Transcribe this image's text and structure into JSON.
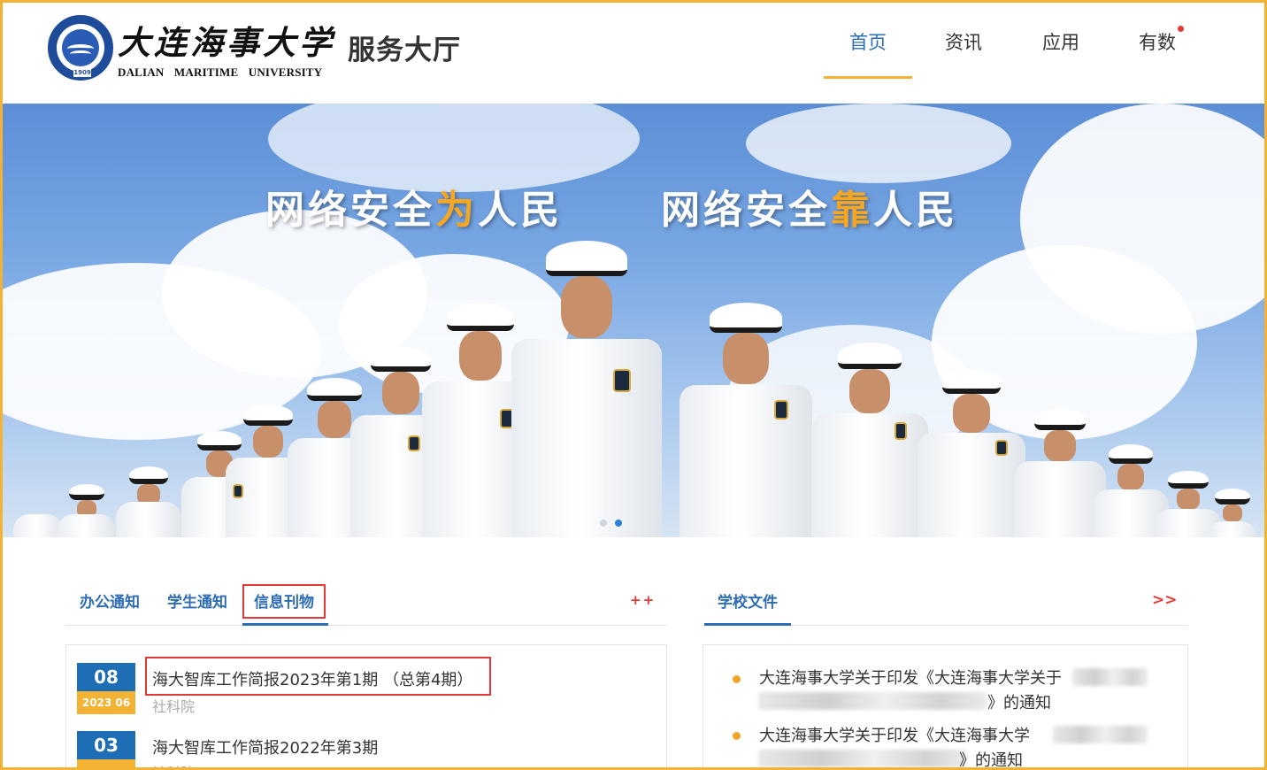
{
  "header": {
    "school_name_cn": "大连海事大学",
    "school_name_en": "DALIAN MARITIME UNIVERSITY",
    "seal_year": "1909",
    "hall_title": "服务大厅",
    "nav": [
      {
        "label": "首页",
        "active": true
      },
      {
        "label": "资讯",
        "active": false
      },
      {
        "label": "应用",
        "active": false
      },
      {
        "label": "有数",
        "active": false,
        "notification_dot": true
      }
    ]
  },
  "banner": {
    "slogan_left": {
      "pre": "网络安全",
      "highlight": "为",
      "post": "人民"
    },
    "slogan_right": {
      "pre": "网络安全",
      "highlight": "靠",
      "post": "人民"
    },
    "carousel_active_index": 1,
    "carousel_count": 2
  },
  "left_panel": {
    "tabs": [
      {
        "label": "办公通知",
        "active": false
      },
      {
        "label": "学生通知",
        "active": false
      },
      {
        "label": "信息刊物",
        "active": true
      }
    ],
    "more_label": "++",
    "items": [
      {
        "day": "08",
        "year_month": "2023 06",
        "title": "海大智库工作简报2023年第1期 （总第4期）",
        "source": "社科院"
      },
      {
        "day": "03",
        "year_month": "",
        "title": "海大智库工作简报2022年第3期",
        "source": "社科院"
      }
    ]
  },
  "right_panel": {
    "tab": "学校文件",
    "more_label": ">>",
    "items": [
      {
        "line1": "大连海事大学关于印发《大连海事大学关于",
        "line2_suffix": "》的通知"
      },
      {
        "line1": "大连海事大学关于印发《大连海事大学",
        "line2_suffix": "》的通知"
      }
    ]
  },
  "colors": {
    "accent_blue": "#2e6cb4",
    "accent_gold": "#f2b233",
    "alert_red": "#e53935"
  }
}
